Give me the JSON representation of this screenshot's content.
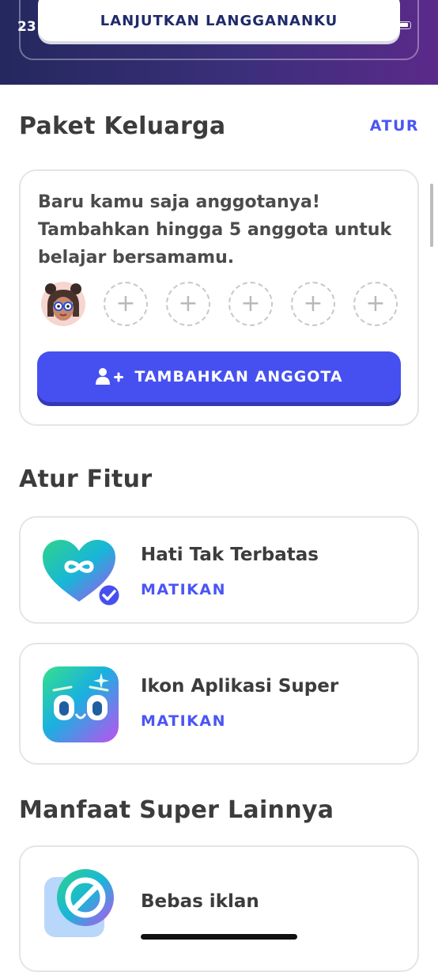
{
  "status_bar": {
    "time": "23"
  },
  "header": {
    "continue_label": "LANJUTKAN LANGGANANKU"
  },
  "family": {
    "title": "Paket Keluarga",
    "manage_label": "ATUR",
    "description": "Baru kamu saja anggotanya! Tambahkan hingga 5 anggota untuk belajar bersamamu.",
    "slot_symbol": "+",
    "add_member_label": "TAMBAHKAN ANGGOTA"
  },
  "features": {
    "title": "Atur Fitur",
    "items": [
      {
        "title": "Hati Tak Terbatas",
        "action": "MATIKAN",
        "icon": "infinity-heart-icon"
      },
      {
        "title": "Ikon Aplikasi Super",
        "action": "MATIKAN",
        "icon": "super-app-icon"
      }
    ]
  },
  "benefits": {
    "title": "Manfaat Super Lainnya",
    "items": [
      {
        "title": "Bebas iklan",
        "icon": "no-ads-icon"
      }
    ]
  },
  "colors": {
    "accent": "#4a55f5",
    "button": "#4650f0",
    "header_start": "#24285e",
    "header_end": "#5b2a8a"
  }
}
